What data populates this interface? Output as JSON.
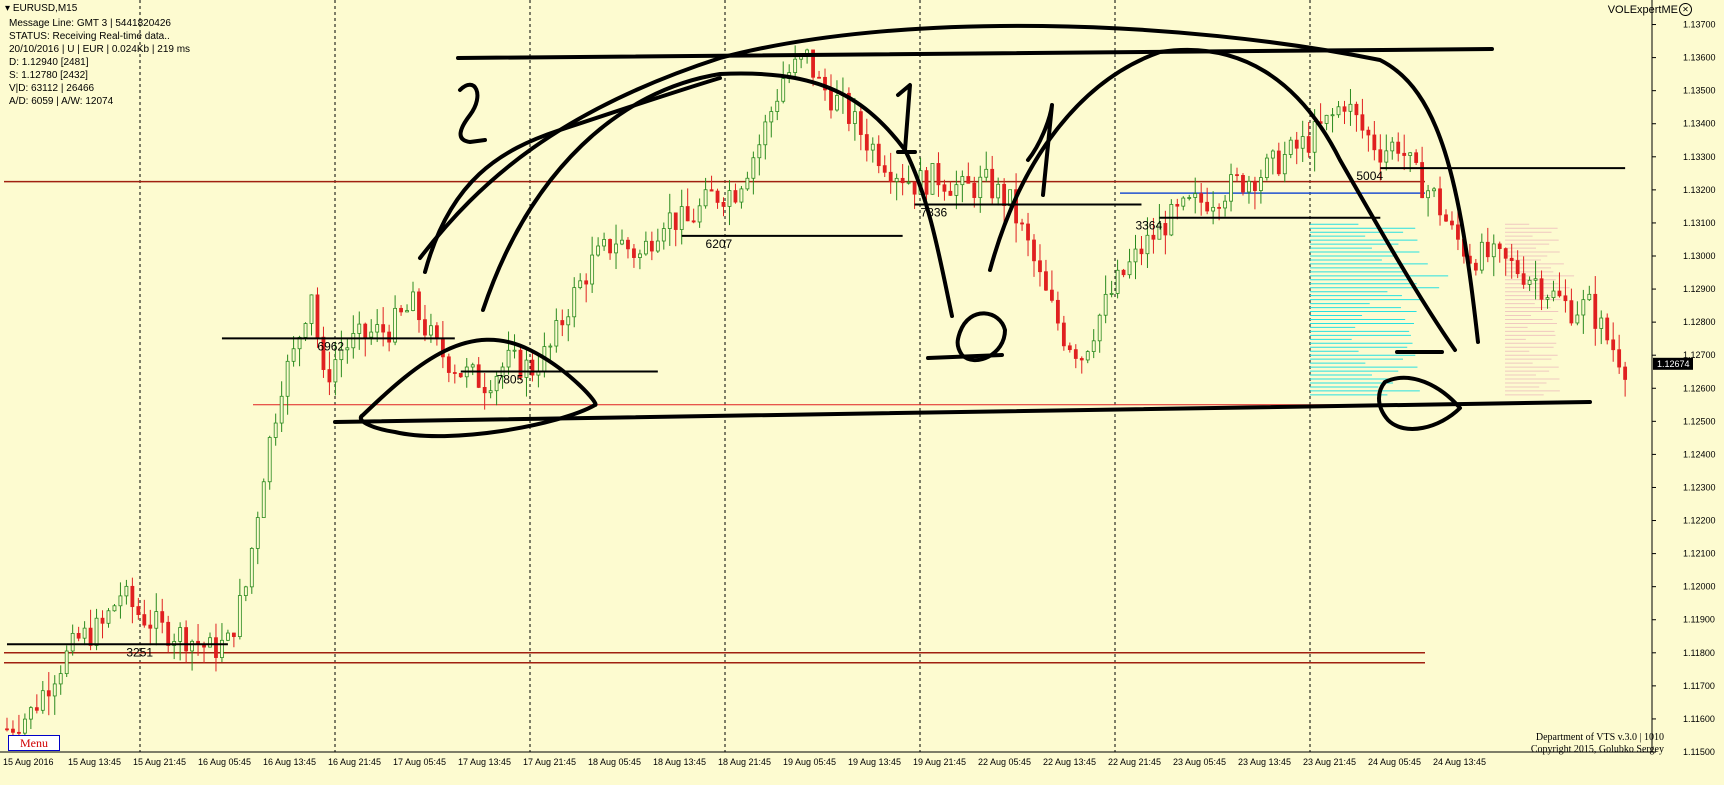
{
  "window": {
    "symbol_title": "EURUSD,M15",
    "indicator_name": "VOLExpertME"
  },
  "info_panel": [
    "Message Line: GMT 3 | 5441820426",
    "STATUS:  Receiving Real-time data..",
    "20/10/2016 | U | EUR | 0.024Kb | 219 ms",
    "D: 1.12940  [2481]",
    "S: 1.12780  [2432]",
    "V|D: 63112 | 26466",
    "A/D: 6059 | A/W: 12074"
  ],
  "menu_label": "Menu",
  "footer": {
    "line1": "Department of VTS  v.3.0 | 1010",
    "line2": "Copyright 2015, Golubko Sergey"
  },
  "colors": {
    "background": "#fdfbd0",
    "bull_candle": "#2a8a1e",
    "bear_candle": "#e02020",
    "resistance_line": "#a02010",
    "blue_level": "#2050d0",
    "volume_profile": "#28e0e0",
    "price_tag_bg": "#000000"
  },
  "chart_data": {
    "type": "candlestick",
    "ylim": [
      1.115,
      1.1375
    ],
    "y_ticks": [
      "1.13700",
      "1.13600",
      "1.13500",
      "1.13400",
      "1.13300",
      "1.13200",
      "1.13100",
      "1.13000",
      "1.12900",
      "1.12800",
      "1.12700",
      "1.12600",
      "1.12500",
      "1.12400",
      "1.12300",
      "1.12200",
      "1.12100",
      "1.12000",
      "1.11900",
      "1.11800",
      "1.11700",
      "1.11600",
      "1.11500"
    ],
    "x_ticks": [
      "15 Aug 2016",
      "15 Aug 13:45",
      "15 Aug 21:45",
      "16 Aug 05:45",
      "16 Aug 13:45",
      "16 Aug 21:45",
      "17 Aug 05:45",
      "17 Aug 13:45",
      "17 Aug 21:45",
      "18 Aug 05:45",
      "18 Aug 13:45",
      "18 Aug 21:45",
      "19 Aug 05:45",
      "19 Aug 13:45",
      "19 Aug 21:45",
      "22 Aug 05:45",
      "22 Aug 13:45",
      "22 Aug 21:45",
      "23 Aug 05:45",
      "23 Aug 13:45",
      "23 Aug 21:45",
      "24 Aug 05:45",
      "24 Aug 13:45"
    ],
    "current_price": "1.12674",
    "price_path": [
      [
        0,
        1.1157
      ],
      [
        4,
        1.1162
      ],
      [
        8,
        1.1174
      ],
      [
        12,
        1.1184
      ],
      [
        16,
        1.1188
      ],
      [
        19,
        1.1198
      ],
      [
        22,
        1.1192
      ],
      [
        26,
        1.1187
      ],
      [
        30,
        1.1185
      ],
      [
        34,
        1.1181
      ],
      [
        37,
        1.1183
      ],
      [
        40,
        1.12
      ],
      [
        43,
        1.1235
      ],
      [
        46,
        1.1262
      ],
      [
        48,
        1.127
      ],
      [
        51,
        1.129
      ],
      [
        53,
        1.1262
      ],
      [
        56,
        1.1272
      ],
      [
        60,
        1.1276
      ],
      [
        64,
        1.1278
      ],
      [
        68,
        1.1285
      ],
      [
        72,
        1.1272
      ],
      [
        76,
        1.1265
      ],
      [
        80,
        1.1262
      ],
      [
        84,
        1.1268
      ],
      [
        88,
        1.1266
      ],
      [
        91,
        1.1272
      ],
      [
        94,
        1.1285
      ],
      [
        98,
        1.1298
      ],
      [
        102,
        1.1305
      ],
      [
        106,
        1.13
      ],
      [
        110,
        1.1312
      ],
      [
        114,
        1.131
      ],
      [
        118,
        1.1318
      ],
      [
        122,
        1.132
      ],
      [
        126,
        1.1334
      ],
      [
        130,
        1.1354
      ],
      [
        134,
        1.136
      ],
      [
        136,
        1.1352
      ],
      [
        140,
        1.1345
      ],
      [
        144,
        1.1335
      ],
      [
        148,
        1.1327
      ],
      [
        152,
        1.1322
      ],
      [
        156,
        1.1324
      ],
      [
        160,
        1.132
      ],
      [
        164,
        1.1322
      ],
      [
        168,
        1.1316
      ],
      [
        171,
        1.1303
      ],
      [
        174,
        1.1288
      ],
      [
        177,
        1.1276
      ],
      [
        180,
        1.127
      ],
      [
        183,
        1.1282
      ],
      [
        186,
        1.1292
      ],
      [
        190,
        1.1302
      ],
      [
        194,
        1.131
      ],
      [
        198,
        1.1315
      ],
      [
        202,
        1.1318
      ],
      [
        206,
        1.1322
      ],
      [
        210,
        1.1325
      ],
      [
        214,
        1.133
      ],
      [
        218,
        1.1335
      ],
      [
        222,
        1.1342
      ],
      [
        224,
        1.1347
      ],
      [
        227,
        1.1338
      ],
      [
        230,
        1.1332
      ],
      [
        233,
        1.1334
      ],
      [
        236,
        1.1324
      ],
      [
        239,
        1.1318
      ],
      [
        242,
        1.1307
      ],
      [
        245,
        1.13
      ],
      [
        248,
        1.13
      ],
      [
        252,
        1.1297
      ],
      [
        256,
        1.1293
      ],
      [
        259,
        1.1288
      ],
      [
        262,
        1.1284
      ],
      [
        265,
        1.1285
      ],
      [
        268,
        1.1275
      ],
      [
        271,
        1.1267
      ]
    ],
    "volume_labels": [
      {
        "text": "3251",
        "x": 22,
        "y": 1.1185
      },
      {
        "text": "6962",
        "x": 54,
        "y": 1.12775
      },
      {
        "text": "7805",
        "x": 84,
        "y": 1.12675
      },
      {
        "text": "6207",
        "x": 119,
        "y": 1.13085
      },
      {
        "text": "7836",
        "x": 155,
        "y": 1.1318
      },
      {
        "text": "3364",
        "x": 191,
        "y": 1.1314
      },
      {
        "text": "5004",
        "x": 228,
        "y": 1.1329
      }
    ],
    "horizontal_levels": [
      1.13225,
      1.118,
      1.1177
    ],
    "blue_level": 1.1319,
    "volume_profile_range": [
      1.1258,
      1.131
    ],
    "annotation_marks": [
      "2",
      "1",
      "1"
    ]
  }
}
